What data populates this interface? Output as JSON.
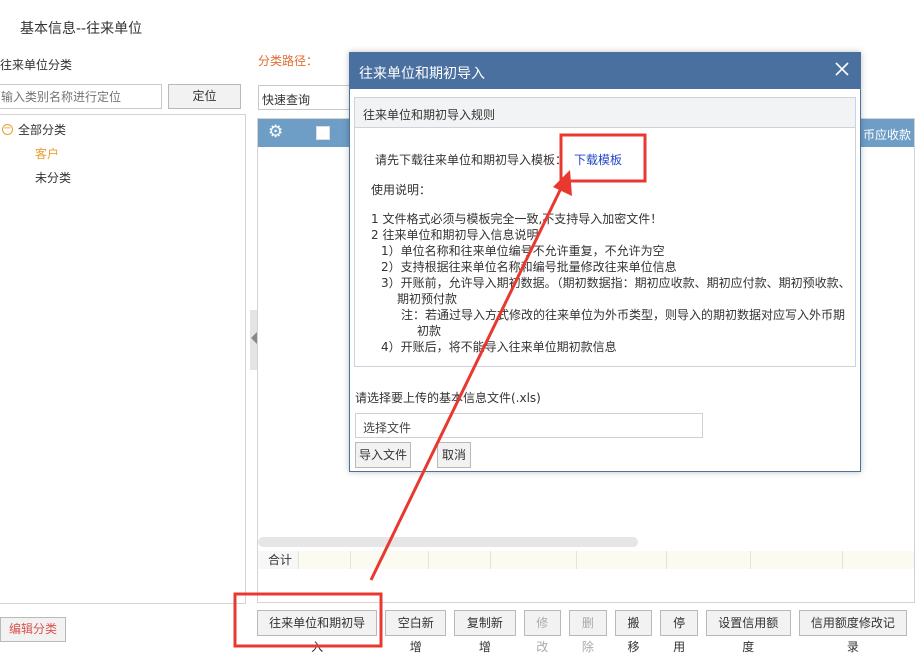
{
  "page": {
    "title": "基本信息--往来单位"
  },
  "left_panel": {
    "header": "往来单位分类",
    "search_placeholder": "输入类别名称进行定位",
    "locate_label": "定位",
    "tree": {
      "root_toggle": "−",
      "root": "全部分类",
      "items": [
        "客户",
        "未分类"
      ]
    },
    "edit_category_label": "编辑分类"
  },
  "main": {
    "path_label": "分类路径：",
    "quick_query_label": "快速查询",
    "grid": {
      "gear_icon": "gear-icon",
      "column_tail": "币应收款",
      "total_label": "合计"
    },
    "buttons": [
      {
        "label": "往来单位和期初导入",
        "disabled": false
      },
      {
        "label": "空白新增",
        "disabled": false
      },
      {
        "label": "复制新增",
        "disabled": false
      },
      {
        "label": "修改",
        "disabled": true
      },
      {
        "label": "删除",
        "disabled": true
      },
      {
        "label": "搬移",
        "disabled": false
      },
      {
        "label": "停用",
        "disabled": false
      },
      {
        "label": "设置信用额度",
        "disabled": false
      },
      {
        "label": "信用额度修改记录",
        "disabled": false
      }
    ]
  },
  "modal": {
    "title": "往来单位和期初导入",
    "rule_header": "往来单位和期初导入规则",
    "template_prompt": "请先下载往来单位和期初导入模板：",
    "download_link": "下载模板",
    "usage_label": "使用说明：",
    "rules": [
      "1 文件格式必须与模板完全一致,不支持导入加密文件！",
      "2 往来单位和期初导入信息说明",
      "1）单位名称和往来单位编号不允许重复，不允许为空",
      "2）支持根据往来单位名称和编号批量修改往来单位信息",
      "3）开账前，允许导入期初数据。（期初数据指：期初应收款、期初应付款、期初预收款、期初预付款",
      "注：若通过导入方式修改的往来单位为外币类型，则导入的期初数据对应写入外币期初款",
      "4）开账后，将不能导入往来单位期初款信息"
    ],
    "select_file_prompt": "请选择要上传的基本信息文件(.xls)",
    "file_input_value": "选择文件",
    "import_label": "导入文件",
    "cancel_label": "取消"
  },
  "colors": {
    "modal_header": "#4a709f",
    "grid_header": "#6e9ec6",
    "accent_orange": "#e59f33",
    "link_blue": "#2348c4",
    "annotation_red": "#e8382f"
  }
}
